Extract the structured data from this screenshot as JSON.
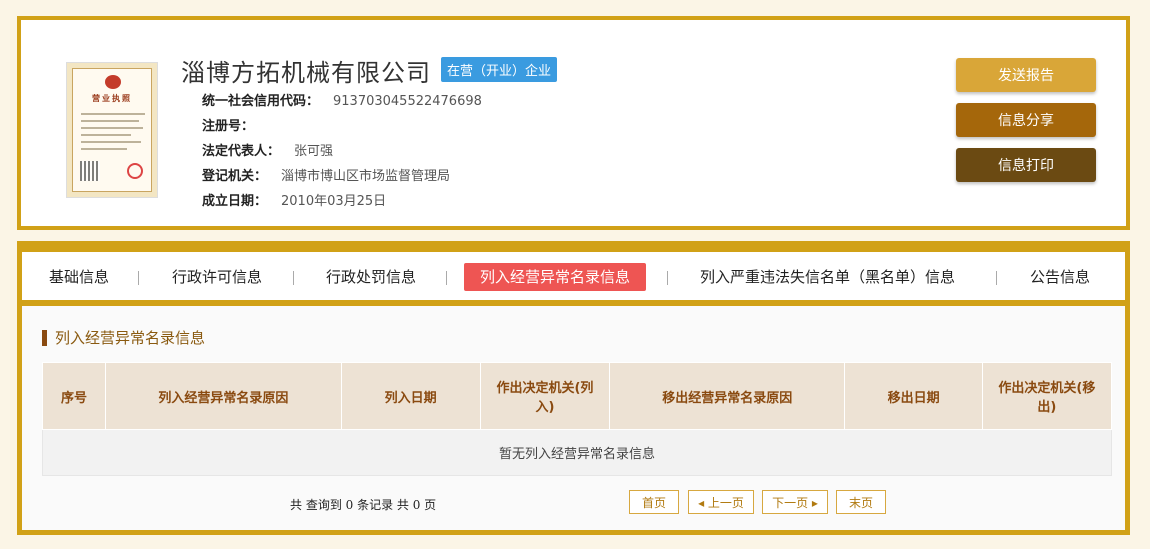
{
  "company": {
    "name": "淄博方拓机械有限公司",
    "status": "在营（开业）企业",
    "license_title": "营业执照"
  },
  "info": [
    {
      "label": "统一社会信用代码：",
      "value": "913703045522476698"
    },
    {
      "label": "注册号：",
      "value": ""
    },
    {
      "label": "法定代表人：",
      "value": "张可强"
    },
    {
      "label": "登记机关：",
      "value": "淄博市博山区市场监督管理局"
    },
    {
      "label": "成立日期：",
      "value": "2010年03月25日"
    }
  ],
  "actions": {
    "send": "发送报告",
    "share": "信息分享",
    "print": "信息打印"
  },
  "tabs": [
    "基础信息",
    "行政许可信息",
    "行政处罚信息",
    "列入经营异常名录信息",
    "列入严重违法失信名单（黑名单）信息",
    "公告信息"
  ],
  "active_tab": "列入经营异常名录信息",
  "section": {
    "title": "列入经营异常名录信息",
    "columns": [
      "序号",
      "列入经营异常名录原因",
      "列入日期",
      "作出决定机关(列入)",
      "移出经营异常名录原因",
      "移出日期",
      "作出决定机关(移出)"
    ],
    "empty_text": "暂无列入经营异常名录信息"
  },
  "pagination": {
    "summary": "共 查询到 0 条记录 共 0 页",
    "first": "首页",
    "prev": "上一页",
    "next": "下一页",
    "last": "末页"
  },
  "colors": {
    "border": "#d1a117",
    "badge": "#3a9be0",
    "active_tab": "#ee5553",
    "btn_send": "#d9a638",
    "btn_share": "#a5670b",
    "btn_print": "#6b4a12"
  }
}
